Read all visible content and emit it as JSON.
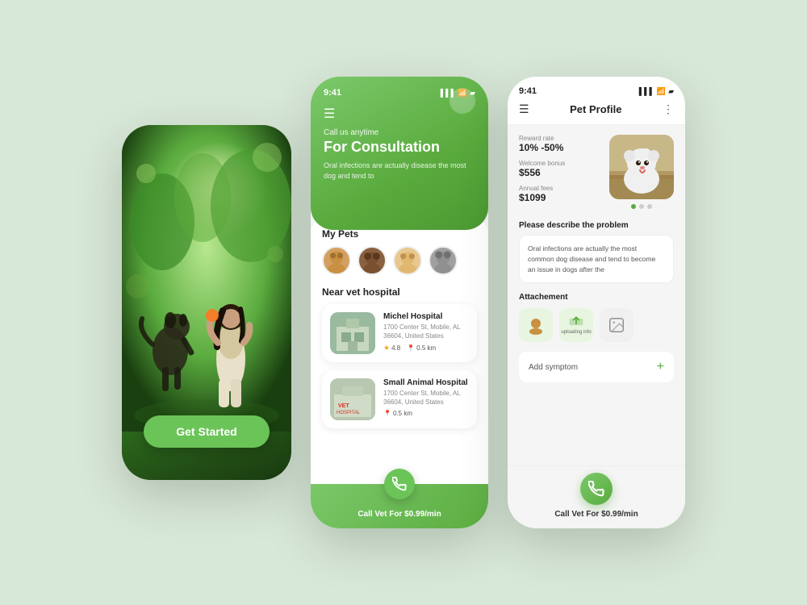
{
  "background_color": "#d8e8d8",
  "accent_color": "#5aab3e",
  "screen1": {
    "get_started_label": "Get Started",
    "scene_description": "Woman playing with dog outdoors"
  },
  "screen2": {
    "status_time": "9:41",
    "status_signal": "▌▌▌",
    "status_wifi": "WiFi",
    "status_battery": "Battery",
    "header_subtitle": "Call us anytime",
    "header_title": "For Consultation",
    "header_desc": "Oral infections are actually\ndisease  the most dog  and tend to",
    "my_pets_label": "My Pets",
    "pets": [
      {
        "id": 1,
        "animal": "dog",
        "color": "#c8a060"
      },
      {
        "id": 2,
        "animal": "dog",
        "color": "#8b6040"
      },
      {
        "id": 3,
        "animal": "dog",
        "color": "#d4a060"
      },
      {
        "id": 4,
        "animal": "cat",
        "color": "#a0a0a0"
      }
    ],
    "near_vet_label": "Near vet hospital",
    "hospitals": [
      {
        "name": "Michel Hospital",
        "address": "1700 Center St, Mobile,\nAL 36604, United States",
        "rating": "4.8",
        "distance": "0.5 km",
        "img_color": "#8aab88"
      },
      {
        "name": "Small Animal Hospital",
        "address": "1700 Center St, Mobile,\nAL 36604, United States",
        "rating": "",
        "distance": "0.5 km",
        "img_color": "#b8c8b0"
      }
    ],
    "call_cta": "Call Vet For $0.99/min"
  },
  "screen3": {
    "status_time": "9:41",
    "title": "Pet Profile",
    "menu_icon": "☰",
    "more_icon": "⋮",
    "reward_rate_label": "Reward rate",
    "reward_rate_value": "10% -50%",
    "welcome_bonus_label": "Welcome bonus",
    "welcome_bonus_value": "$556",
    "annual_fees_label": "Annual fees",
    "annual_fees_value": "$1099",
    "photo_dots": [
      true,
      false,
      false
    ],
    "problem_title": "Please describe the problem",
    "problem_text": "Oral infections are actually the most common dog disease and tend to become an issue in dogs after the",
    "attachment_title": "Attachement",
    "attachments": [
      {
        "icon": "🐕",
        "label": ""
      },
      {
        "icon": "☁",
        "label": "uploading info"
      },
      {
        "icon": "🖼",
        "label": ""
      }
    ],
    "add_symptom_label": "Add symptom",
    "call_cta": "Call Vet For $0.99/min"
  }
}
